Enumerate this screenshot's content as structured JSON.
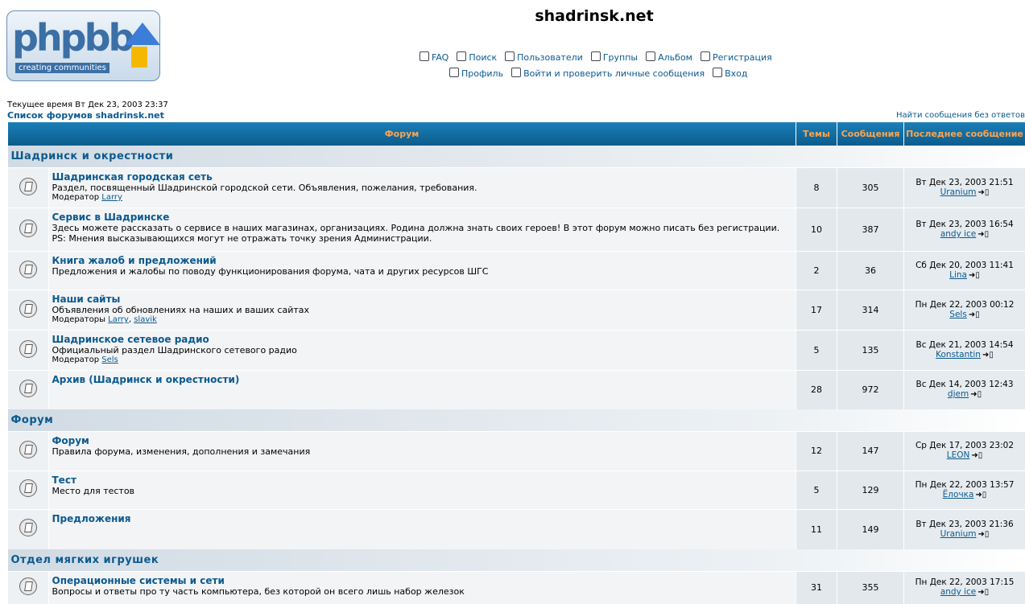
{
  "logo": {
    "text": "phpbb",
    "tagline": "creating communities"
  },
  "site_title": "shadrinsk.net",
  "nav_row1": [
    {
      "label": "FAQ",
      "icon": "faq-icon"
    },
    {
      "label": "Поиск",
      "icon": "search-icon"
    },
    {
      "label": "Пользователи",
      "icon": "members-icon"
    },
    {
      "label": "Группы",
      "icon": "groups-icon"
    },
    {
      "label": "Альбом",
      "icon": "album-icon"
    },
    {
      "label": "Регистрация",
      "icon": "register-icon"
    }
  ],
  "nav_row2": [
    {
      "label": "Профиль",
      "icon": "profile-icon"
    },
    {
      "label": "Войти и проверить личные сообщения",
      "icon": "messages-icon"
    },
    {
      "label": "Вход",
      "icon": "login-icon"
    }
  ],
  "current_time": "Текущее время Вт Дек 23, 2003 23:37",
  "index_link": "Список форумов shadrinsk.net",
  "unanswered_link": "Найти сообщения без ответов",
  "columns": {
    "forum": "Форум",
    "topics": "Темы",
    "posts": "Сообщения",
    "last_post": "Последнее сообщение"
  },
  "categories": [
    {
      "name": "Шадринск и окрестности",
      "forums": [
        {
          "name": "Шадринская городская сеть",
          "desc": [
            "Раздел, посвященный Шадринской городской сети. Объявления, пожелания, требования."
          ],
          "mod_label": "Модератор",
          "mods": [
            "Larry"
          ],
          "topics": "8",
          "posts": "305",
          "last_date": "Вт Дек 23, 2003 21:51",
          "last_user": "Uranium",
          "h": 50
        },
        {
          "name": "Сервис в Шадринске",
          "desc": [
            "Здесь можете рассказать о сервисе в наших магазинах, организациях. Родина должна знать своих героев! В этот форум можно писать без регистрации.",
            "PS: Мнения высказывающихся могут не отражать точку зрения Администрации."
          ],
          "mod_label": "",
          "mods": [],
          "topics": "10",
          "posts": "387",
          "last_date": "Вт Дек 23, 2003 16:54",
          "last_user": "andy ice",
          "h": 54
        },
        {
          "name": "Книга жалоб и предложений",
          "desc": [
            "Предложения и жалобы по поводу функционирования форума, чата и других ресурсов ШГС"
          ],
          "mod_label": "",
          "mods": [],
          "topics": "2",
          "posts": "36",
          "last_date": "Сб Дек 20, 2003 11:41",
          "last_user": "Lina",
          "h": 48
        },
        {
          "name": "Наши сайты",
          "desc": [
            "Объявления об обновлениях на наших и ваших сайтах"
          ],
          "mod_label": "Модераторы",
          "mods": [
            "Larry",
            "slavik"
          ],
          "topics": "17",
          "posts": "314",
          "last_date": "Пн Дек 22, 2003 00:12",
          "last_user": "Sels",
          "h": 49
        },
        {
          "name": "Шадринское сетевое радио",
          "desc": [
            "Официальный раздел Шадринского сетевого радио"
          ],
          "mod_label": "Модератор",
          "mods": [
            "Sels"
          ],
          "topics": "5",
          "posts": "135",
          "last_date": "Вс Дек 21, 2003 14:54",
          "last_user": "Konstantin",
          "h": 48
        },
        {
          "name": "Архив (Шадринск и окрестности)",
          "desc": [],
          "mod_label": "",
          "mods": [],
          "topics": "28",
          "posts": "972",
          "last_date": "Вс Дек 14, 2003 12:43",
          "last_user": "djem",
          "h": 48
        }
      ]
    },
    {
      "name": "Форум",
      "forums": [
        {
          "name": "Форум",
          "desc": [
            "Правила форума, изменения, дополнения и замечания"
          ],
          "mod_label": "",
          "mods": [],
          "topics": "12",
          "posts": "147",
          "last_date": "Ср Дек 17, 2003 23:02",
          "last_user": "LEON",
          "h": 49
        },
        {
          "name": "Тест",
          "desc": [
            "Место для тестов"
          ],
          "mod_label": "",
          "mods": [],
          "topics": "5",
          "posts": "129",
          "last_date": "Пн Дек 22, 2003 13:57",
          "last_user": "Ёлочка",
          "h": 48
        },
        {
          "name": "Предложения",
          "desc": [],
          "mod_label": "",
          "mods": [],
          "topics": "11",
          "posts": "149",
          "last_date": "Вт Дек 23, 2003 21:36",
          "last_user": "Uranium",
          "h": 50
        }
      ]
    },
    {
      "name": "Отдел мягких игрушек",
      "forums": [
        {
          "name": "Операционные системы и сети",
          "desc": [
            "Вопросы и ответы про ту часть компьютера, без которой он всего лишь набор железок"
          ],
          "mod_label": "",
          "mods": [],
          "topics": "31",
          "posts": "355",
          "last_date": "Пн Дек 22, 2003 17:15",
          "last_user": "andy ice",
          "h": 40
        }
      ]
    }
  ]
}
